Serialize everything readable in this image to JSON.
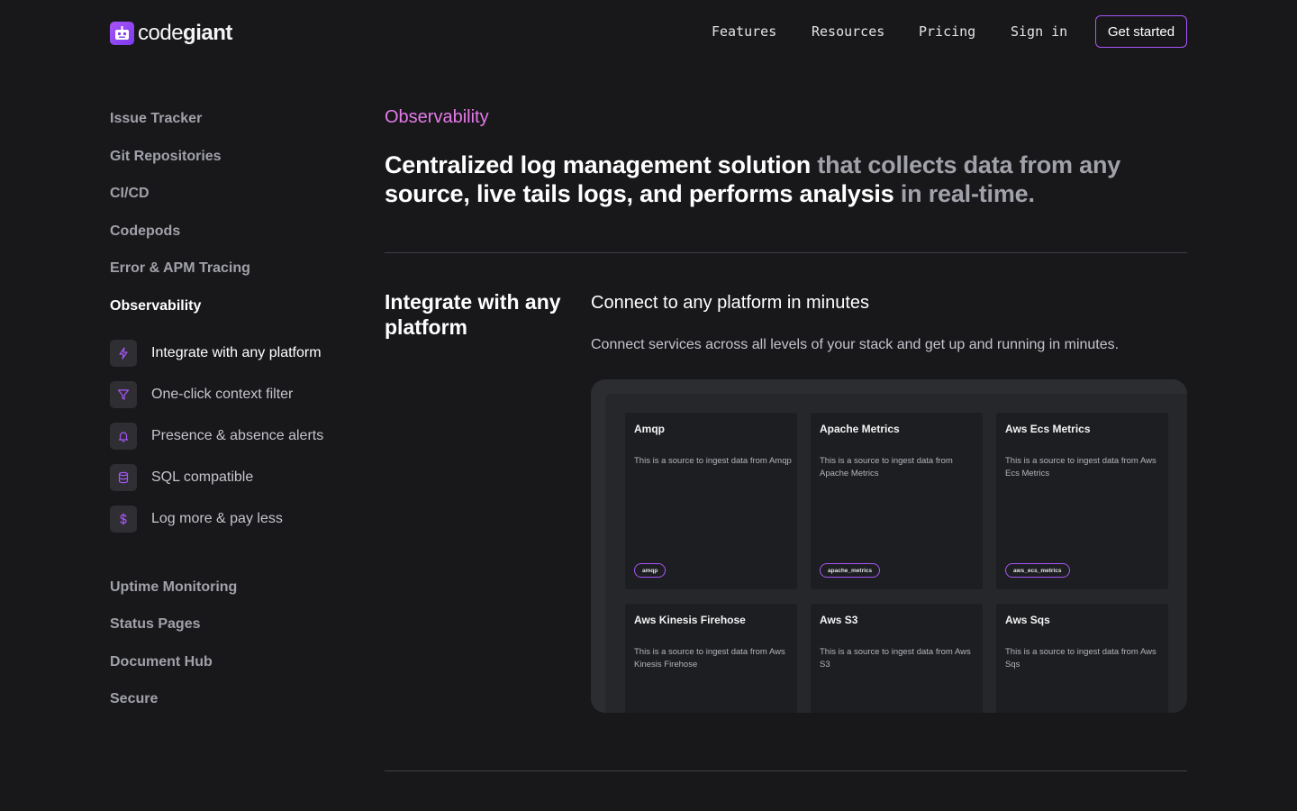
{
  "header": {
    "logo_light": "code",
    "logo_bold": "giant",
    "nav": {
      "features": "Features",
      "resources": "Resources",
      "pricing": "Pricing",
      "sign_in": "Sign in"
    },
    "cta": "Get started"
  },
  "sidebar": {
    "top_items": [
      {
        "label": "Issue Tracker"
      },
      {
        "label": "Git Repositories"
      },
      {
        "label": "CI/CD"
      },
      {
        "label": "Codepods"
      },
      {
        "label": "Error & APM Tracing"
      },
      {
        "label": "Observability"
      }
    ],
    "sub_items": [
      {
        "label": "Integrate with any platform",
        "icon": "lightning-icon"
      },
      {
        "label": "One-click context filter",
        "icon": "filter-icon"
      },
      {
        "label": "Presence & absence alerts",
        "icon": "bell-icon"
      },
      {
        "label": "SQL compatible",
        "icon": "database-icon"
      },
      {
        "label": "Log more & pay less",
        "icon": "dollar-icon"
      }
    ],
    "bottom_items": [
      {
        "label": "Uptime Monitoring"
      },
      {
        "label": "Status Pages"
      },
      {
        "label": "Document Hub"
      },
      {
        "label": "Secure"
      }
    ]
  },
  "main": {
    "eyebrow": "Observability",
    "headline_strong": "Centralized log management solution",
    "headline_muted_1": " that collects data from any",
    "headline_strong_2": "source, live tails logs, and performs analysis",
    "headline_muted_2": " in real-time.",
    "section_title": "Integrate with any platform",
    "section_subtitle": "Connect to any platform in minutes",
    "section_description": "Connect services across all levels of your stack and get up and running in minutes."
  },
  "preview": {
    "cards": [
      {
        "title": "Amqp",
        "desc": "This is a source to ingest data from Amqp",
        "tag": "amqp"
      },
      {
        "title": "Apache Metrics",
        "desc": "This is a source to ingest data from Apache Metrics",
        "tag": "apache_metrics"
      },
      {
        "title": "Aws Ecs Metrics",
        "desc": "This is a source to ingest data from Aws Ecs Metrics",
        "tag": "aws_ecs_metrics"
      },
      {
        "title": "Aws Kinesis Firehose",
        "desc": "This is a source to ingest data from Aws Kinesis Firehose",
        "tag": ""
      },
      {
        "title": "Aws S3",
        "desc": "This is a source to ingest data from Aws S3",
        "tag": ""
      },
      {
        "title": "Aws Sqs",
        "desc": "This is a source to ingest data from Aws Sqs",
        "tag": ""
      }
    ]
  },
  "colors": {
    "background": "#18181b",
    "accent_purple": "#a855f7",
    "eyebrow_pink": "#e47ae8"
  }
}
